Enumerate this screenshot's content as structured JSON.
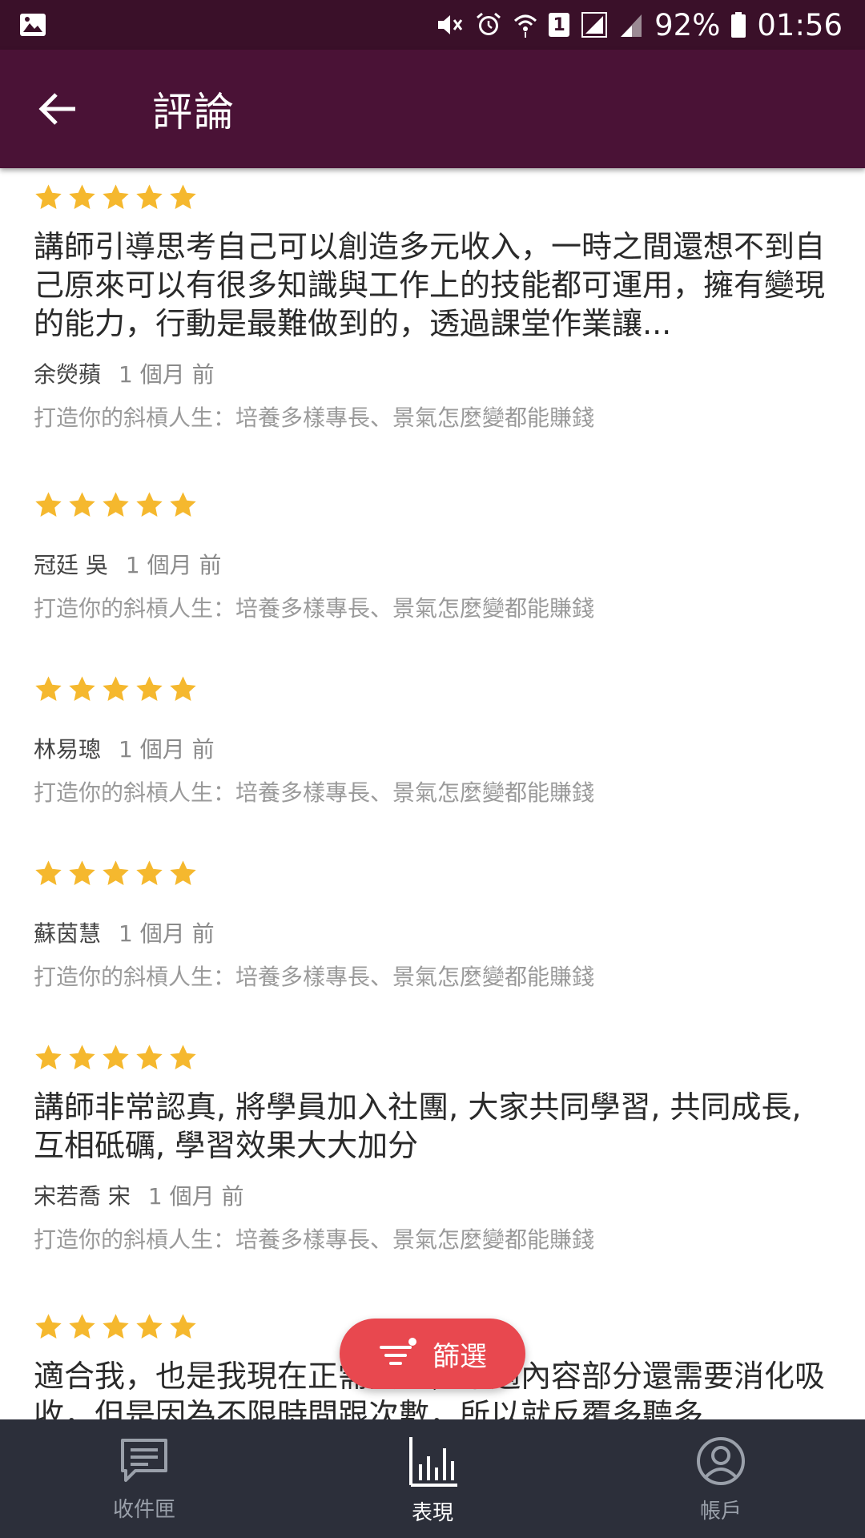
{
  "status_bar": {
    "battery": "92%",
    "time": "01:56",
    "sim_slot": "1"
  },
  "app_bar": {
    "title": "評論"
  },
  "reviews": [
    {
      "rating": 5,
      "text": "講師引導思考自己可以創造多元收入，一時之間還想不到自己原來可以有很多知識與工作上的技能都可運用，擁有變現的能力，行動是最難做到的，透過課堂作業讓...",
      "author": "余熒蘋",
      "time": "1 個月 前",
      "course": "打造你的斜槓人生：培養多樣專長、景氣怎麼變都能賺錢"
    },
    {
      "rating": 5,
      "text": "",
      "author": "冠廷 吳",
      "time": "1 個月 前",
      "course": "打造你的斜槓人生：培養多樣專長、景氣怎麼變都能賺錢"
    },
    {
      "rating": 5,
      "text": "",
      "author": "林易璁",
      "time": "1 個月 前",
      "course": "打造你的斜槓人生：培養多樣專長、景氣怎麼變都能賺錢"
    },
    {
      "rating": 5,
      "text": "",
      "author": "蘇茵慧",
      "time": "1 個月 前",
      "course": "打造你的斜槓人生：培養多樣專長、景氣怎麼變都能賺錢"
    },
    {
      "rating": 5,
      "text": "講師非常認真, 將學員加入社團, 大家共同學習, 共同成長, 互相砥礪, 學習效果大大加分",
      "author": "宋若喬 宋",
      "time": "1 個月 前",
      "course": "打造你的斜槓人生：培養多樣專長、景氣怎麼變都能賺錢"
    },
    {
      "rating": 5,
      "text": "適合我，也是我現在正需要的，不過內容部分還需要消化吸收，但是因為不限時間跟次數，所以就反覆多聽多",
      "author": "",
      "time": "",
      "course": ""
    }
  ],
  "filter_button": {
    "label": "篩選"
  },
  "bottom_nav": {
    "items": [
      {
        "label": "收件匣",
        "icon": "chat-icon",
        "active": false
      },
      {
        "label": "表現",
        "icon": "bar-chart-icon",
        "active": true
      },
      {
        "label": "帳戶",
        "icon": "account-icon",
        "active": false
      }
    ]
  },
  "colors": {
    "status_bar": "#3a1029",
    "app_bar": "#4a1236",
    "star": "#f5b82e",
    "fab": "#e8484f",
    "bottom_nav": "#2c2f3a"
  }
}
